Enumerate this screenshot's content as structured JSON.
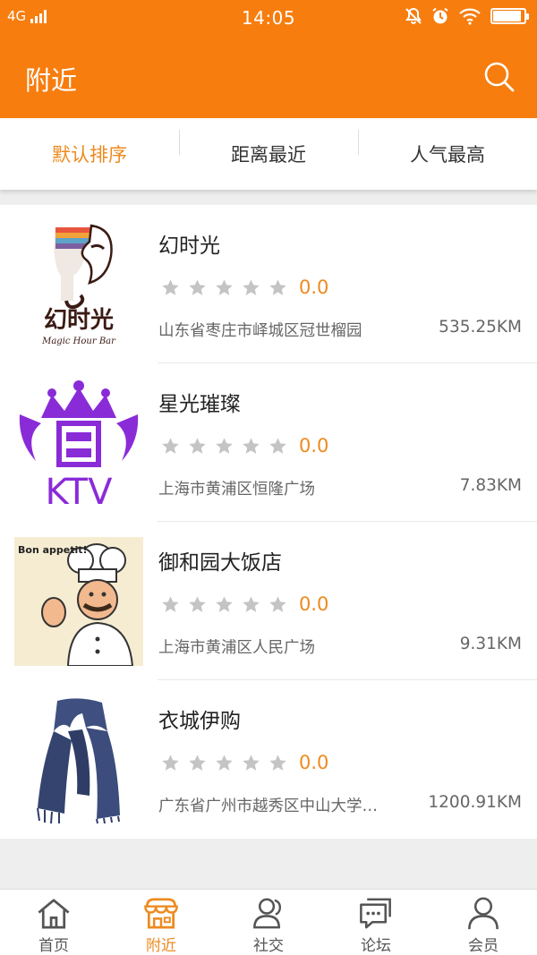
{
  "status_bar": {
    "network": "4G",
    "time": "14:05",
    "battery_level": 0.9,
    "icons": [
      "signal-icon",
      "mute-icon",
      "alarm-icon",
      "wifi-icon",
      "battery-icon"
    ]
  },
  "header": {
    "title": "附近",
    "search_icon": "search-icon"
  },
  "sort_tabs": [
    {
      "label": "默认排序",
      "active": true
    },
    {
      "label": "距离最近",
      "active": false
    },
    {
      "label": "人气最高",
      "active": false
    }
  ],
  "places": [
    {
      "name": "幻时光",
      "rating": "0.0",
      "stars_filled": 0,
      "address": "山东省枣庄市峄城区冠世榴园",
      "distance": "535.25KM",
      "thumb_text": "幻时光",
      "thumb_subtext": "Magic Hour Bar"
    },
    {
      "name": "星光璀璨",
      "rating": "0.0",
      "stars_filled": 0,
      "address": "上海市黄浦区恒隆广场",
      "distance": "7.83KM",
      "thumb_text": "KTV"
    },
    {
      "name": "御和园大饭店",
      "rating": "0.0",
      "stars_filled": 0,
      "address": "上海市黄浦区人民广场",
      "distance": "9.31KM",
      "thumb_text": "Bon appetit!"
    },
    {
      "name": "衣城伊购",
      "rating": "0.0",
      "stars_filled": 0,
      "address": "广东省广州市越秀区中山大学…",
      "distance": "1200.91KM"
    }
  ],
  "tabbar": [
    {
      "label": "首页",
      "icon": "home-icon",
      "active": false
    },
    {
      "label": "附近",
      "icon": "shop-icon",
      "active": true
    },
    {
      "label": "社交",
      "icon": "people-icon",
      "active": false
    },
    {
      "label": "论坛",
      "icon": "chat-icon",
      "active": false
    },
    {
      "label": "会员",
      "icon": "person-icon",
      "active": false
    }
  ],
  "colors": {
    "accent": "#f77d0e",
    "active_text": "#ee8a1f",
    "star_empty": "#c4c4c4"
  }
}
